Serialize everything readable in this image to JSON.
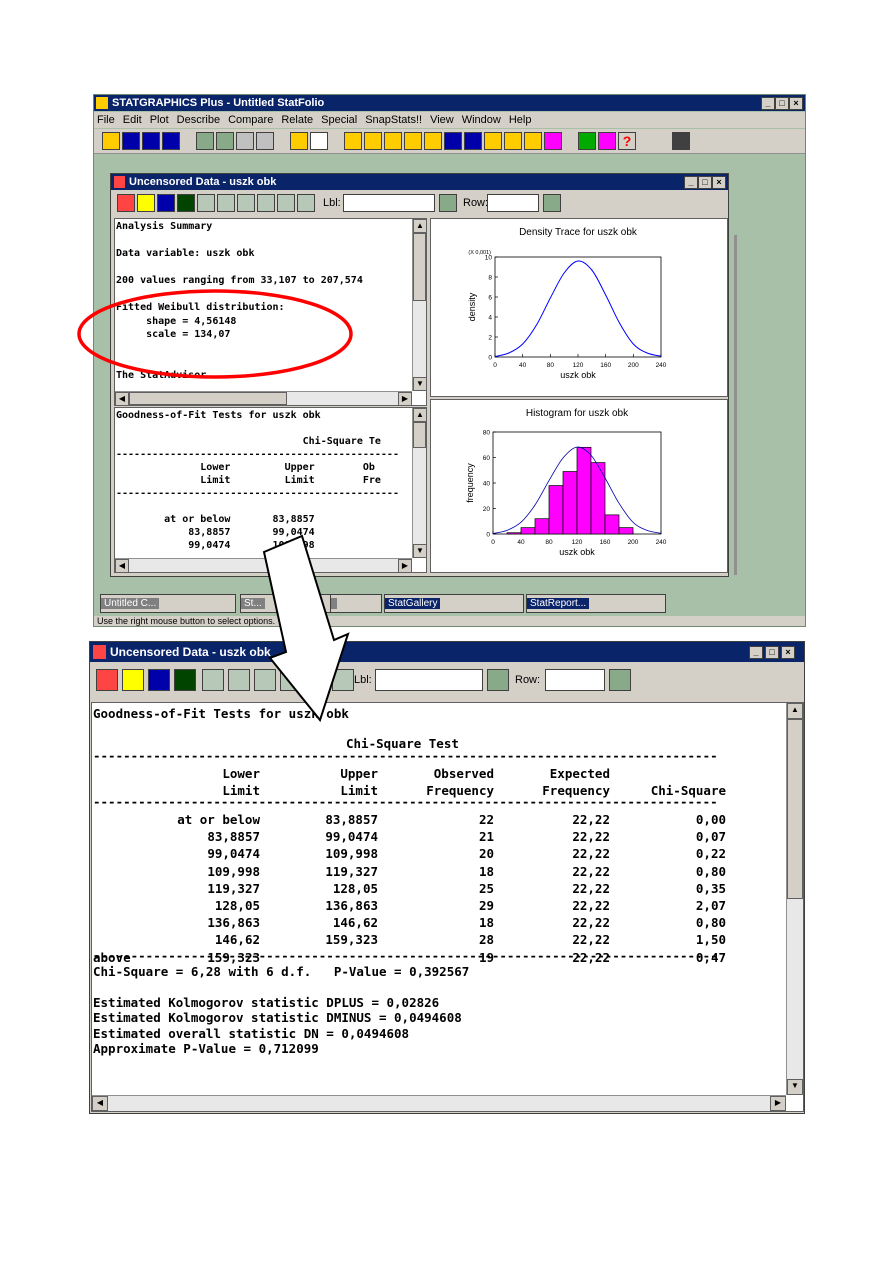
{
  "app": {
    "title": "STATGRAPHICS Plus - Untitled StatFolio",
    "menu": [
      "File",
      "Edit",
      "Plot",
      "Describe",
      "Compare",
      "Relate",
      "Special",
      "SnapStats!!",
      "View",
      "Window",
      "Help"
    ],
    "status": "Use the right mouse button to select options."
  },
  "window": {
    "title": "Uncensored Data - uszk obk",
    "lbl_label": "Lbl:",
    "row_label": "Row:"
  },
  "summary": {
    "lines": [
      "Analysis Summary",
      "",
      "Data variable: uszk obk",
      "",
      "200 values ranging from 33,107 to 207,574",
      "",
      "Fitted Weibull distribution:",
      "     shape = 4,56148",
      "     scale = 134,07",
      "",
      "",
      "The StatAdvisor"
    ]
  },
  "density_chart": {
    "title": "Density Trace for uszk obk",
    "multiplier": "(X 0,001)",
    "xlabel": "uszk obk",
    "ylabel": "density",
    "xticks": [
      "0",
      "40",
      "80",
      "120",
      "160",
      "200",
      "240"
    ],
    "yticks": [
      "0",
      "2",
      "4",
      "6",
      "8",
      "10"
    ]
  },
  "histogram_chart": {
    "title": "Histogram for uszk obk",
    "xlabel": "uszk obk",
    "ylabel": "frequency",
    "xticks": [
      "0",
      "40",
      "80",
      "120",
      "160",
      "200",
      "240"
    ],
    "yticks": [
      "0",
      "20",
      "40",
      "60",
      "80"
    ]
  },
  "chart_data": [
    {
      "type": "line",
      "title": "Density Trace for uszk obk",
      "xlabel": "uszk obk",
      "ylabel": "density",
      "xlim": [
        0,
        240
      ],
      "ylim": [
        0,
        10
      ],
      "x": [
        0,
        20,
        40,
        60,
        80,
        100,
        120,
        140,
        160,
        180,
        200,
        220,
        240
      ],
      "y": [
        0.05,
        0.4,
        1.3,
        3.2,
        5.9,
        8.4,
        9.6,
        8.7,
        6.2,
        3.4,
        1.3,
        0.4,
        0.08
      ]
    },
    {
      "type": "bar",
      "title": "Histogram for uszk obk",
      "xlabel": "uszk obk",
      "ylabel": "frequency",
      "xlim": [
        0,
        240
      ],
      "ylim": [
        0,
        80
      ],
      "bins": [
        [
          20,
          40
        ],
        [
          40,
          60
        ],
        [
          60,
          80
        ],
        [
          80,
          100
        ],
        [
          100,
          120
        ],
        [
          120,
          140
        ],
        [
          140,
          160
        ],
        [
          160,
          180
        ],
        [
          180,
          200
        ]
      ],
      "values": [
        1,
        5,
        12,
        38,
        49,
        68,
        56,
        15,
        5
      ]
    }
  ],
  "gof_small": {
    "lines": [
      "Goodness-of-Fit Tests for uszk obk",
      "",
      "                               Chi-Square Te",
      "-----------------------------------------------",
      "              Lower         Upper        Ob",
      "              Limit         Limit        Fre",
      "-----------------------------------------------",
      "",
      "        at or below       83,8857",
      "            83,8857       99,0474",
      "            99,0474       109,998"
    ]
  },
  "taskbar": [
    {
      "label": "Untitled C..."
    },
    {
      "label": "St..."
    },
    {
      "label": ""
    },
    {
      "label": "StatGallery"
    },
    {
      "label": "StatReport..."
    }
  ],
  "gof": {
    "title": "Goodness-of-Fit Tests for uszk obk",
    "test": "Chi-Square Test",
    "dash": "----------------------------------------------------------------------------------------",
    "headers1": [
      "Lower",
      "Upper",
      "Observed",
      "Expected",
      ""
    ],
    "headers2": [
      "Limit",
      "Limit",
      "Frequency",
      "Frequency",
      "Chi-Square"
    ],
    "rows": [
      [
        "",
        "at or below",
        "83,8857",
        "22",
        "22,22",
        "0,00"
      ],
      [
        "",
        "83,8857",
        "99,0474",
        "21",
        "22,22",
        "0,07"
      ],
      [
        "",
        "99,0474",
        "109,998",
        "20",
        "22,22",
        "0,22"
      ],
      [
        "",
        "109,998",
        "119,327",
        "18",
        "22,22",
        "0,80"
      ],
      [
        "",
        "119,327",
        "128,05",
        "25",
        "22,22",
        "0,35"
      ],
      [
        "",
        "128,05",
        "136,863",
        "29",
        "22,22",
        "2,07"
      ],
      [
        "",
        "136,863",
        "146,62",
        "18",
        "22,22",
        "0,80"
      ],
      [
        "",
        "146,62",
        "159,323",
        "28",
        "22,22",
        "1,50"
      ],
      [
        "above",
        "159,323",
        "",
        "19",
        "22,22",
        "0,47"
      ]
    ],
    "summary": [
      "Chi-Square = 6,28 with 6 d.f.   P-Value = 0,392567",
      "",
      "Estimated Kolmogorov statistic DPLUS = 0,02826",
      "Estimated Kolmogorov statistic DMINUS = 0,0494608",
      "Estimated overall statistic DN = 0,0494608",
      "Approximate P-Value = 0,712099"
    ]
  },
  "colors": {
    "titlebar": "#0a246a",
    "histogram_bar": "#ff00ff",
    "density_line": "#0000ff",
    "annotation": "#ff0000"
  }
}
